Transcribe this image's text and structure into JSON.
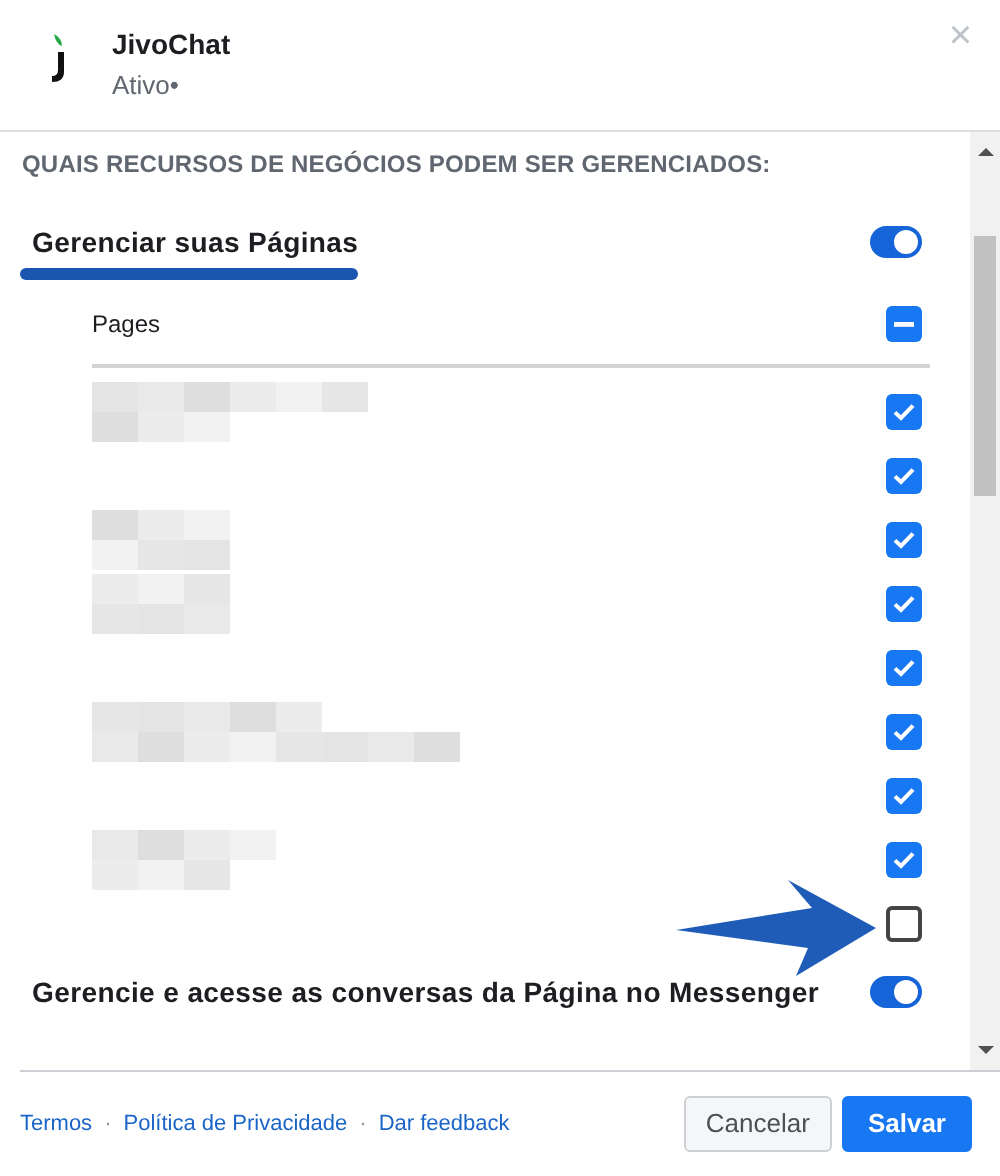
{
  "app": {
    "name": "JivoChat",
    "status": "Ativo•",
    "close": "×"
  },
  "section_heading": "QUAIS RECURSOS DE NEGÓCIOS PODEM SER GERENCIADOS:",
  "permissions": [
    {
      "label": "Gerenciar suas Páginas",
      "on": true
    },
    {
      "label": "Gerencie e acesse as conversas da Página no Messenger",
      "on": true
    }
  ],
  "pages": {
    "header": "Pages",
    "partial": true,
    "items": [
      {
        "checked": true
      },
      {
        "checked": true
      },
      {
        "checked": true
      },
      {
        "checked": true
      },
      {
        "checked": true
      },
      {
        "checked": true
      },
      {
        "checked": true
      },
      {
        "checked": true
      },
      {
        "checked": false
      }
    ]
  },
  "footer": {
    "links": [
      "Termos",
      "Política de Privacidade",
      "Dar feedback"
    ],
    "separator": "·",
    "buttons": [
      {
        "label": "Cancelar",
        "kind": "secondary"
      },
      {
        "label": "Salvar",
        "kind": "primary"
      }
    ]
  }
}
